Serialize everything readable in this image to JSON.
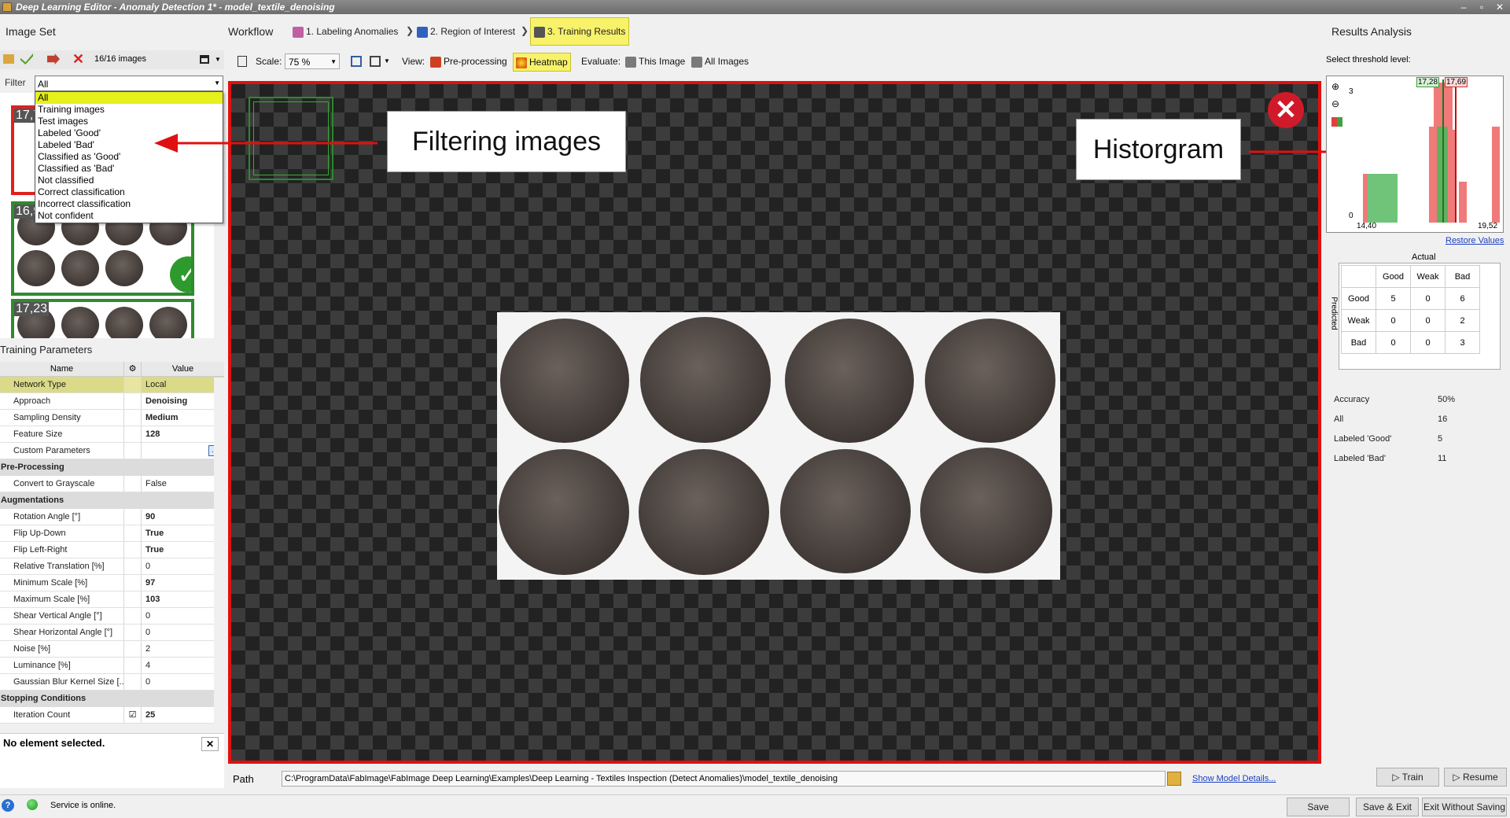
{
  "app": {
    "title": "Deep Learning Editor - Anomaly Detection 1* - model_textile_denoising"
  },
  "image_set": {
    "title": "Image Set",
    "count": "16/16 images",
    "filter_label": "Filter",
    "filter_value": "All",
    "filter_options": [
      "All",
      "Training images",
      "Test images",
      "Labeled 'Good'",
      "Labeled 'Bad'",
      "Classified as 'Good'",
      "Classified as 'Bad'",
      "Not classified",
      "Correct classification",
      "Incorrect classification",
      "Not confident"
    ],
    "thumbs": [
      {
        "score": "17,7"
      },
      {
        "score": "16,95"
      },
      {
        "score": "17,23"
      }
    ]
  },
  "workflow": {
    "title": "Workflow",
    "steps": [
      "1. Labeling Anomalies",
      "2. Region of Interest",
      "3. Training Results"
    ]
  },
  "toolbar": {
    "scale_label": "Scale:",
    "scale_value": "75 %",
    "view_label": "View:",
    "preprocessing": "Pre-processing",
    "heatmap": "Heatmap",
    "evaluate_label": "Evaluate:",
    "this_image": "This Image",
    "all_images": "All Images"
  },
  "params": {
    "title": "Training Parameters",
    "col_name": "Name",
    "col_value": "Value",
    "rows": [
      {
        "type": "row",
        "name": "Network Type",
        "value": "Local",
        "hl": true
      },
      {
        "type": "row",
        "name": "Approach",
        "value": "Denoising",
        "bold": true
      },
      {
        "type": "row",
        "name": "Sampling Density",
        "value": "Medium",
        "bold": true
      },
      {
        "type": "row",
        "name": "Feature Size",
        "value": "128",
        "bold": true
      },
      {
        "type": "row",
        "name": "Custom Parameters",
        "value": ""
      },
      {
        "type": "cat",
        "name": "Pre-Processing"
      },
      {
        "type": "row",
        "name": "Convert to Grayscale",
        "value": "False"
      },
      {
        "type": "cat",
        "name": "Augmentations"
      },
      {
        "type": "row",
        "name": "Rotation Angle [°]",
        "value": "90",
        "bold": true
      },
      {
        "type": "row",
        "name": "Flip Up-Down",
        "value": "True",
        "bold": true
      },
      {
        "type": "row",
        "name": "Flip Left-Right",
        "value": "True",
        "bold": true
      },
      {
        "type": "row",
        "name": "Relative Translation [%]",
        "value": "0"
      },
      {
        "type": "row",
        "name": "Minimum Scale [%]",
        "value": "97",
        "bold": true
      },
      {
        "type": "row",
        "name": "Maximum Scale [%]",
        "value": "103",
        "bold": true
      },
      {
        "type": "row",
        "name": "Shear Vertical Angle [°]",
        "value": "0"
      },
      {
        "type": "row",
        "name": "Shear Horizontal Angle [°]",
        "value": "0"
      },
      {
        "type": "row",
        "name": "Noise [%]",
        "value": "2"
      },
      {
        "type": "row",
        "name": "Luminance [%]",
        "value": "4"
      },
      {
        "type": "row",
        "name": "Gaussian Blur Kernel Size [...",
        "value": "0"
      },
      {
        "type": "cat",
        "name": "Stopping Conditions"
      },
      {
        "type": "row",
        "name": "Iteration Count",
        "value": "25",
        "bold": true,
        "check": true
      }
    ],
    "no_selection": "No element selected."
  },
  "callouts": {
    "filtering": "Filtering images",
    "histogram": "Historgram"
  },
  "results": {
    "title": "Results Analysis",
    "threshold_label": "Select threshold level:",
    "hist_ymax": "3",
    "hist_ymin": "0",
    "hist_xmin": "14,40",
    "hist_xmax": "19,52",
    "thr_low": "17,28",
    "thr_high": "17,69",
    "restore": "Restore Values",
    "actual": "Actual",
    "predicted": "Predicted",
    "cols": [
      "Good",
      "Weak",
      "Bad"
    ],
    "matrix": [
      {
        "label": "Good",
        "vals": [
          "5",
          "0",
          "6"
        ]
      },
      {
        "label": "Weak",
        "vals": [
          "0",
          "0",
          "2"
        ]
      },
      {
        "label": "Bad",
        "vals": [
          "0",
          "0",
          "3"
        ]
      }
    ],
    "stats": [
      {
        "k": "Accuracy",
        "v": "50%"
      },
      {
        "k": "All",
        "v": "16"
      },
      {
        "k": "Labeled 'Good'",
        "v": "5"
      },
      {
        "k": "Labeled 'Bad'",
        "v": "11"
      }
    ]
  },
  "path": {
    "label": "Path",
    "value": "C:\\ProgramData\\FabImage\\FabImage Deep Learning\\Examples\\Deep Learning - Textiles Inspection (Detect Anomalies)\\model_textile_denoising",
    "details": "Show Model Details..."
  },
  "actions": {
    "train": "Train",
    "resume": "Resume",
    "save": "Save",
    "save_exit": "Save & Exit",
    "exit": "Exit Without Saving"
  },
  "status": {
    "text": "Service is online."
  }
}
